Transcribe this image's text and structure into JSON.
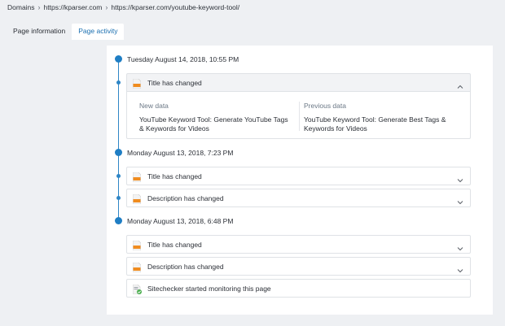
{
  "breadcrumb": {
    "items": [
      "Domains",
      "https://kparser.com",
      "https://kparser.com/youtube-keyword-tool/"
    ]
  },
  "tabs": [
    {
      "label": "Page information",
      "active": false
    },
    {
      "label": "Page activity",
      "active": true
    }
  ],
  "timeline": {
    "groups": [
      {
        "date": "Tuesday August 14, 2018, 10:55 PM",
        "items": [
          {
            "label": "Title has changed",
            "expanded": true,
            "new_data_label": "New data",
            "new_data": "YouTube Keyword Tool: Generate YouTube Tags & Keywords for Videos",
            "previous_data_label": "Previous data",
            "previous_data": "YouTube Keyword Tool: Generate Best Tags & Keywords for Videos"
          }
        ]
      },
      {
        "date": "Monday August 13, 2018, 7:23 PM",
        "items": [
          {
            "label": "Title has changed",
            "expanded": false
          },
          {
            "label": "Description has changed",
            "expanded": false
          }
        ]
      },
      {
        "date": "Monday August 13, 2018, 6:48 PM",
        "items": [
          {
            "label": "Title has changed",
            "expanded": false
          },
          {
            "label": "Description has changed",
            "expanded": false
          },
          {
            "label": "Sitechecker started monitoring this page",
            "expanded": false
          }
        ]
      }
    ]
  },
  "colors": {
    "accent": "#1f7ec4",
    "icon_orange": "#f08c1f",
    "icon_green": "#4caf50"
  }
}
